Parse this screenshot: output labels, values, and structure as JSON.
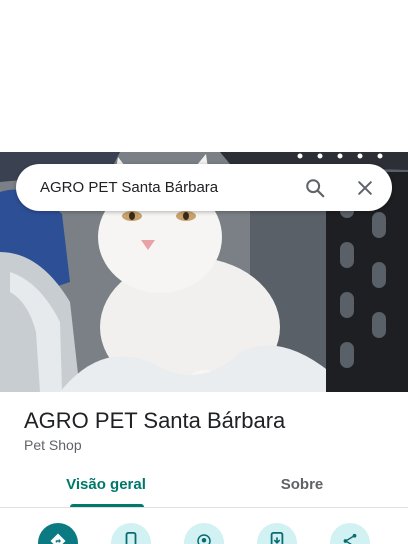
{
  "search": {
    "query": "AGRO PET Santa Bárbara",
    "icons": [
      "search-icon",
      "close-icon"
    ]
  },
  "place": {
    "name": "AGRO PET Santa Bárbara",
    "category": "Pet Shop"
  },
  "tabs": [
    {
      "label": "Visão geral",
      "active": true
    },
    {
      "label": "Sobre",
      "active": false
    }
  ],
  "actions": [
    {
      "icon": "directions-icon",
      "style": "primary"
    },
    {
      "icon": "phone-icon",
      "style": "secondary"
    },
    {
      "icon": "nearby-icon",
      "style": "secondary"
    },
    {
      "icon": "save-to-phone-icon",
      "style": "secondary"
    },
    {
      "icon": "share-icon",
      "style": "secondary"
    }
  ],
  "colors": {
    "accent": "#00796b",
    "action_primary": "#0b7a82",
    "action_secondary": "#d2f1f3",
    "text_primary": "#202124",
    "text_secondary": "#5f6368"
  }
}
